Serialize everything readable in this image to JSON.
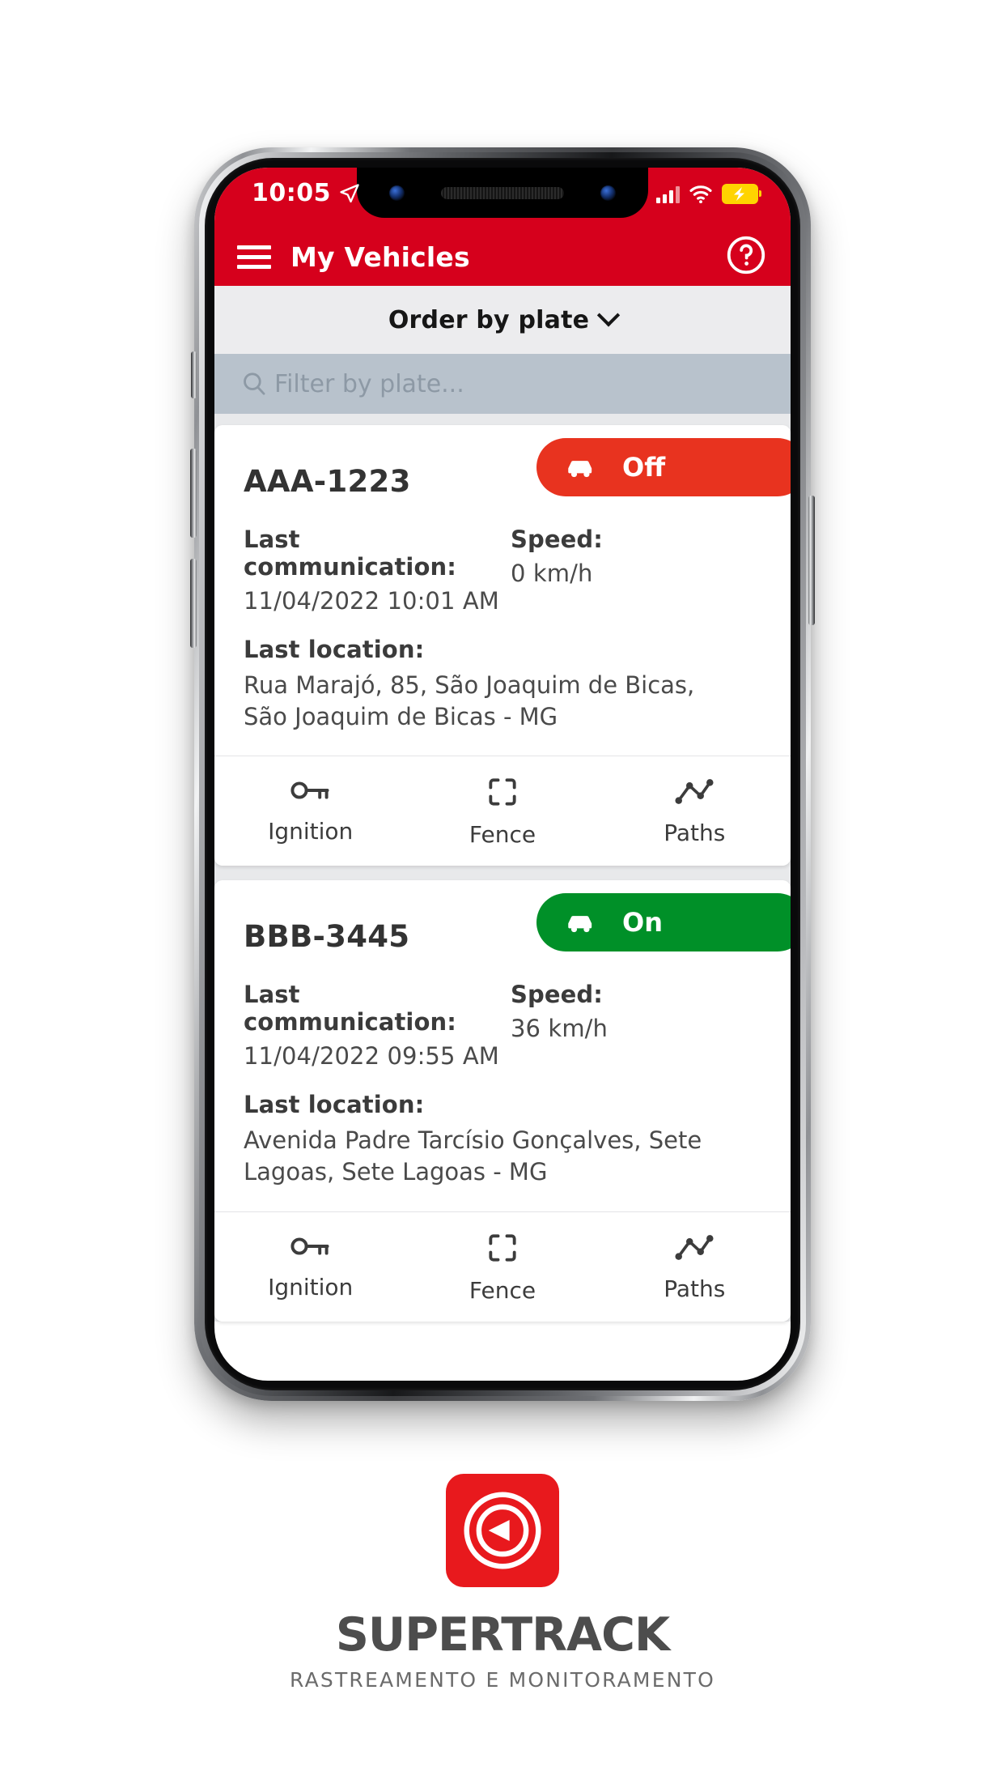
{
  "status_bar": {
    "time": "10:05",
    "location_icon": "navigation-arrow-icon",
    "signal_icon": "cellular-signal-icon",
    "wifi_icon": "wifi-icon",
    "battery_icon": "battery-charging-icon",
    "background_color": "#d6001c"
  },
  "nav_bar": {
    "menu_icon": "hamburger-menu-icon",
    "title": "My Vehicles",
    "help_icon": "help-circle-icon",
    "background_color": "#d6001c"
  },
  "toolbar": {
    "order_label": "Order by plate",
    "order_caret_icon": "chevron-down-icon",
    "search_icon": "search-icon",
    "search_value": "",
    "search_placeholder": "Filter by plate..."
  },
  "vehicles": [
    {
      "plate": "AAA-1223",
      "status_label": "Off",
      "status_state": "off",
      "status_color": "#e8331f",
      "status_icon": "car-icon",
      "last_communication_label": "Last communication:",
      "last_communication_value": "11/04/2022 10:01 AM",
      "speed_label": "Speed:",
      "speed_value": "0 km/h",
      "last_location_label": "Last location:",
      "last_location_value": "Rua Marajó, 85, São Joaquim de Bicas, São Joaquim de Bicas - MG",
      "actions": [
        {
          "label": "Ignition",
          "icon": "key-icon"
        },
        {
          "label": "Fence",
          "icon": "geofence-corners-icon"
        },
        {
          "label": "Paths",
          "icon": "route-line-chart-icon"
        }
      ]
    },
    {
      "plate": "BBB-3445",
      "status_label": "On",
      "status_state": "on",
      "status_color": "#009028",
      "status_icon": "car-icon",
      "last_communication_label": "Last communication:",
      "last_communication_value": "11/04/2022 09:55 AM",
      "speed_label": "Speed:",
      "speed_value": "36 km/h",
      "last_location_label": "Last location:",
      "last_location_value": "Avenida Padre Tarcísio Gonçalves, Sete Lagoas, Sete Lagoas - MG",
      "actions": [
        {
          "label": "Ignition",
          "icon": "key-icon"
        },
        {
          "label": "Fence",
          "icon": "geofence-corners-icon"
        },
        {
          "label": "Paths",
          "icon": "route-line-chart-icon"
        }
      ]
    }
  ],
  "brand": {
    "logo_icon": "supertrack-radar-logo-icon",
    "name_part_1": "SUPER",
    "name_part_2": "TRACK",
    "name": "SUPERTRACK",
    "tagline": "RASTREAMENTO E MONITORAMENTO",
    "logo_color": "#e8191d"
  }
}
